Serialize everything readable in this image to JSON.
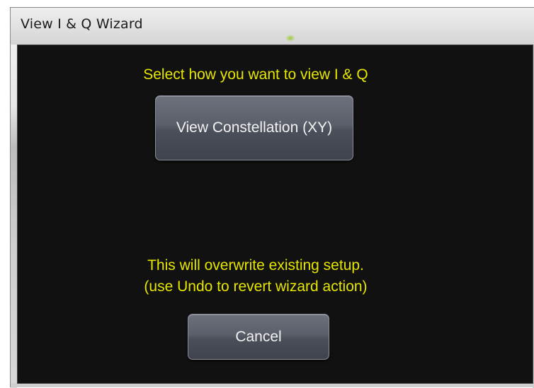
{
  "window": {
    "title": "View I & Q Wizard"
  },
  "dialog": {
    "prompt": "Select how you want to view I & Q",
    "constellation_button_label": "View Constellation (XY)",
    "warning_line1": "This will overwrite existing setup.",
    "warning_line2": "(use Undo to revert wizard action)",
    "cancel_button_label": "Cancel"
  },
  "colors": {
    "background": "#111111",
    "text_accent": "#e6e600",
    "button": "#5a5f6a",
    "titlebar": "#e2e2e2"
  }
}
